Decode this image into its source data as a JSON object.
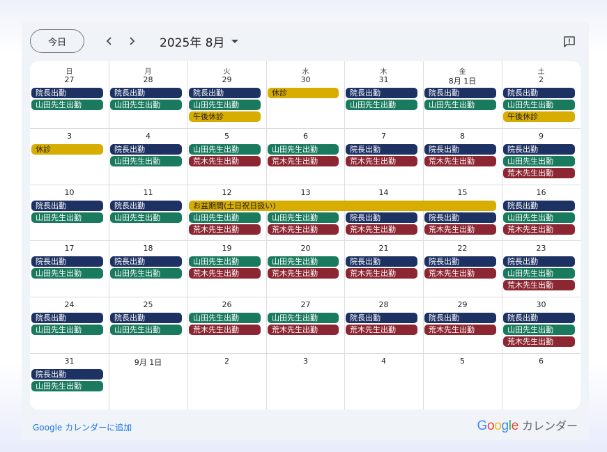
{
  "toolbar": {
    "today_label": "今日",
    "prev_label": "‹",
    "next_label": "›",
    "month_label": "2025年 8月",
    "caret": "▼"
  },
  "weekdays": [
    "日",
    "月",
    "火",
    "水",
    "木",
    "金",
    "土"
  ],
  "colors": {
    "director": "#1e3163",
    "yamada": "#1a7a5e",
    "araki": "#8c2632",
    "closed": "#d7ad00"
  },
  "weeks": [
    {
      "days": [
        "27",
        "28",
        "29",
        "30",
        "31",
        "8月 1日",
        "2"
      ],
      "events": [
        {
          "text": "院長出勤",
          "start": 0,
          "span": 1,
          "slot": 0,
          "kind": "director"
        },
        {
          "text": "山田先生出勤",
          "start": 0,
          "span": 1,
          "slot": 1,
          "kind": "yamada"
        },
        {
          "text": "院長出勤",
          "start": 1,
          "span": 1,
          "slot": 0,
          "kind": "director"
        },
        {
          "text": "山田先生出勤",
          "start": 1,
          "span": 1,
          "slot": 1,
          "kind": "yamada"
        },
        {
          "text": "院長出勤",
          "start": 2,
          "span": 1,
          "slot": 0,
          "kind": "director"
        },
        {
          "text": "山田先生出勤",
          "start": 2,
          "span": 1,
          "slot": 1,
          "kind": "yamada"
        },
        {
          "text": "午後休診",
          "start": 2,
          "span": 1,
          "slot": 2,
          "kind": "closed"
        },
        {
          "text": "休診",
          "start": 3,
          "span": 1,
          "slot": 0,
          "kind": "closed"
        },
        {
          "text": "院長出勤",
          "start": 4,
          "span": 1,
          "slot": 0,
          "kind": "director"
        },
        {
          "text": "山田先生出勤",
          "start": 4,
          "span": 1,
          "slot": 1,
          "kind": "yamada"
        },
        {
          "text": "院長出勤",
          "start": 5,
          "span": 1,
          "slot": 0,
          "kind": "director"
        },
        {
          "text": "山田先生出勤",
          "start": 5,
          "span": 1,
          "slot": 1,
          "kind": "yamada"
        },
        {
          "text": "院長出勤",
          "start": 6,
          "span": 1,
          "slot": 0,
          "kind": "director"
        },
        {
          "text": "山田先生出勤",
          "start": 6,
          "span": 1,
          "slot": 1,
          "kind": "yamada"
        },
        {
          "text": "午後休診",
          "start": 6,
          "span": 1,
          "slot": 2,
          "kind": "closed"
        }
      ]
    },
    {
      "days": [
        "3",
        "4",
        "5",
        "6",
        "7",
        "8",
        "9"
      ],
      "events": [
        {
          "text": "休診",
          "start": 0,
          "span": 1,
          "slot": 0,
          "kind": "closed"
        },
        {
          "text": "院長出勤",
          "start": 1,
          "span": 1,
          "slot": 0,
          "kind": "director"
        },
        {
          "text": "山田先生出勤",
          "start": 1,
          "span": 1,
          "slot": 1,
          "kind": "yamada"
        },
        {
          "text": "山田先生出勤",
          "start": 2,
          "span": 1,
          "slot": 0,
          "kind": "yamada"
        },
        {
          "text": "荒木先生出勤",
          "start": 2,
          "span": 1,
          "slot": 1,
          "kind": "araki"
        },
        {
          "text": "山田先生出勤",
          "start": 3,
          "span": 1,
          "slot": 0,
          "kind": "yamada"
        },
        {
          "text": "荒木先生出勤",
          "start": 3,
          "span": 1,
          "slot": 1,
          "kind": "araki"
        },
        {
          "text": "院長出勤",
          "start": 4,
          "span": 1,
          "slot": 0,
          "kind": "director"
        },
        {
          "text": "荒木先生出勤",
          "start": 4,
          "span": 1,
          "slot": 1,
          "kind": "araki"
        },
        {
          "text": "院長出勤",
          "start": 5,
          "span": 1,
          "slot": 0,
          "kind": "director"
        },
        {
          "text": "荒木先生出勤",
          "start": 5,
          "span": 1,
          "slot": 1,
          "kind": "araki"
        },
        {
          "text": "院長出勤",
          "start": 6,
          "span": 1,
          "slot": 0,
          "kind": "director"
        },
        {
          "text": "山田先生出勤",
          "start": 6,
          "span": 1,
          "slot": 1,
          "kind": "yamada"
        },
        {
          "text": "荒木先生出勤",
          "start": 6,
          "span": 1,
          "slot": 2,
          "kind": "araki"
        }
      ]
    },
    {
      "days": [
        "10",
        "11",
        "12",
        "13",
        "14",
        "15",
        "16"
      ],
      "events": [
        {
          "text": "院長出勤",
          "start": 0,
          "span": 1,
          "slot": 0,
          "kind": "director"
        },
        {
          "text": "山田先生出勤",
          "start": 0,
          "span": 1,
          "slot": 1,
          "kind": "yamada"
        },
        {
          "text": "院長出勤",
          "start": 1,
          "span": 1,
          "slot": 0,
          "kind": "director"
        },
        {
          "text": "山田先生出勤",
          "start": 1,
          "span": 1,
          "slot": 1,
          "kind": "yamada"
        },
        {
          "text": "お盆期間(土日祝日扱い)",
          "start": 2,
          "span": 4,
          "slot": 0,
          "kind": "closed"
        },
        {
          "text": "山田先生出勤",
          "start": 2,
          "span": 1,
          "slot": 1,
          "kind": "yamada"
        },
        {
          "text": "荒木先生出勤",
          "start": 2,
          "span": 1,
          "slot": 2,
          "kind": "araki"
        },
        {
          "text": "山田先生出勤",
          "start": 3,
          "span": 1,
          "slot": 1,
          "kind": "yamada"
        },
        {
          "text": "荒木先生出勤",
          "start": 3,
          "span": 1,
          "slot": 2,
          "kind": "araki"
        },
        {
          "text": "院長出勤",
          "start": 4,
          "span": 1,
          "slot": 1,
          "kind": "director"
        },
        {
          "text": "荒木先生出勤",
          "start": 4,
          "span": 1,
          "slot": 2,
          "kind": "araki"
        },
        {
          "text": "院長出勤",
          "start": 5,
          "span": 1,
          "slot": 1,
          "kind": "director"
        },
        {
          "text": "荒木先生出勤",
          "start": 5,
          "span": 1,
          "slot": 2,
          "kind": "araki"
        },
        {
          "text": "院長出勤",
          "start": 6,
          "span": 1,
          "slot": 0,
          "kind": "director"
        },
        {
          "text": "山田先生出勤",
          "start": 6,
          "span": 1,
          "slot": 1,
          "kind": "yamada"
        },
        {
          "text": "荒木先生出勤",
          "start": 6,
          "span": 1,
          "slot": 2,
          "kind": "araki"
        }
      ]
    },
    {
      "days": [
        "17",
        "18",
        "19",
        "20",
        "21",
        "22",
        "23"
      ],
      "events": [
        {
          "text": "院長出勤",
          "start": 0,
          "span": 1,
          "slot": 0,
          "kind": "director"
        },
        {
          "text": "山田先生出勤",
          "start": 0,
          "span": 1,
          "slot": 1,
          "kind": "yamada"
        },
        {
          "text": "院長出勤",
          "start": 1,
          "span": 1,
          "slot": 0,
          "kind": "director"
        },
        {
          "text": "山田先生出勤",
          "start": 1,
          "span": 1,
          "slot": 1,
          "kind": "yamada"
        },
        {
          "text": "山田先生出勤",
          "start": 2,
          "span": 1,
          "slot": 0,
          "kind": "yamada"
        },
        {
          "text": "荒木先生出勤",
          "start": 2,
          "span": 1,
          "slot": 1,
          "kind": "araki"
        },
        {
          "text": "山田先生出勤",
          "start": 3,
          "span": 1,
          "slot": 0,
          "kind": "yamada"
        },
        {
          "text": "荒木先生出勤",
          "start": 3,
          "span": 1,
          "slot": 1,
          "kind": "araki"
        },
        {
          "text": "院長出勤",
          "start": 4,
          "span": 1,
          "slot": 0,
          "kind": "director"
        },
        {
          "text": "荒木先生出勤",
          "start": 4,
          "span": 1,
          "slot": 1,
          "kind": "araki"
        },
        {
          "text": "院長出勤",
          "start": 5,
          "span": 1,
          "slot": 0,
          "kind": "director"
        },
        {
          "text": "荒木先生出勤",
          "start": 5,
          "span": 1,
          "slot": 1,
          "kind": "araki"
        },
        {
          "text": "院長出勤",
          "start": 6,
          "span": 1,
          "slot": 0,
          "kind": "director"
        },
        {
          "text": "山田先生出勤",
          "start": 6,
          "span": 1,
          "slot": 1,
          "kind": "yamada"
        },
        {
          "text": "荒木先生出勤",
          "start": 6,
          "span": 1,
          "slot": 2,
          "kind": "araki"
        }
      ]
    },
    {
      "days": [
        "24",
        "25",
        "26",
        "27",
        "28",
        "29",
        "30"
      ],
      "events": [
        {
          "text": "院長出勤",
          "start": 0,
          "span": 1,
          "slot": 0,
          "kind": "director"
        },
        {
          "text": "山田先生出勤",
          "start": 0,
          "span": 1,
          "slot": 1,
          "kind": "yamada"
        },
        {
          "text": "院長出勤",
          "start": 1,
          "span": 1,
          "slot": 0,
          "kind": "director"
        },
        {
          "text": "山田先生出勤",
          "start": 1,
          "span": 1,
          "slot": 1,
          "kind": "yamada"
        },
        {
          "text": "山田先生出勤",
          "start": 2,
          "span": 1,
          "slot": 0,
          "kind": "yamada"
        },
        {
          "text": "荒木先生出勤",
          "start": 2,
          "span": 1,
          "slot": 1,
          "kind": "araki"
        },
        {
          "text": "山田先生出勤",
          "start": 3,
          "span": 1,
          "slot": 0,
          "kind": "yamada"
        },
        {
          "text": "荒木先生出勤",
          "start": 3,
          "span": 1,
          "slot": 1,
          "kind": "araki"
        },
        {
          "text": "院長出勤",
          "start": 4,
          "span": 1,
          "slot": 0,
          "kind": "director"
        },
        {
          "text": "荒木先生出勤",
          "start": 4,
          "span": 1,
          "slot": 1,
          "kind": "araki"
        },
        {
          "text": "院長出勤",
          "start": 5,
          "span": 1,
          "slot": 0,
          "kind": "director"
        },
        {
          "text": "荒木先生出勤",
          "start": 5,
          "span": 1,
          "slot": 1,
          "kind": "araki"
        },
        {
          "text": "院長出勤",
          "start": 6,
          "span": 1,
          "slot": 0,
          "kind": "director"
        },
        {
          "text": "山田先生出勤",
          "start": 6,
          "span": 1,
          "slot": 1,
          "kind": "yamada"
        },
        {
          "text": "荒木先生出勤",
          "start": 6,
          "span": 1,
          "slot": 2,
          "kind": "araki"
        }
      ]
    },
    {
      "days": [
        "31",
        "9月 1日",
        "2",
        "3",
        "4",
        "5",
        "6"
      ],
      "events": [
        {
          "text": "院長出勤",
          "start": 0,
          "span": 1,
          "slot": 0,
          "kind": "director"
        },
        {
          "text": "山田先生出勤",
          "start": 0,
          "span": 1,
          "slot": 1,
          "kind": "yamada"
        }
      ]
    }
  ],
  "footer": {
    "add_link": "Google カレンダーに追加",
    "brand_letters": [
      {
        "ch": "G",
        "color": "#4285f4"
      },
      {
        "ch": "o",
        "color": "#ea4335"
      },
      {
        "ch": "o",
        "color": "#fbbc05"
      },
      {
        "ch": "g",
        "color": "#4285f4"
      },
      {
        "ch": "l",
        "color": "#34a853"
      },
      {
        "ch": "e",
        "color": "#ea4335"
      }
    ],
    "brand_suffix": "カレンダー"
  }
}
